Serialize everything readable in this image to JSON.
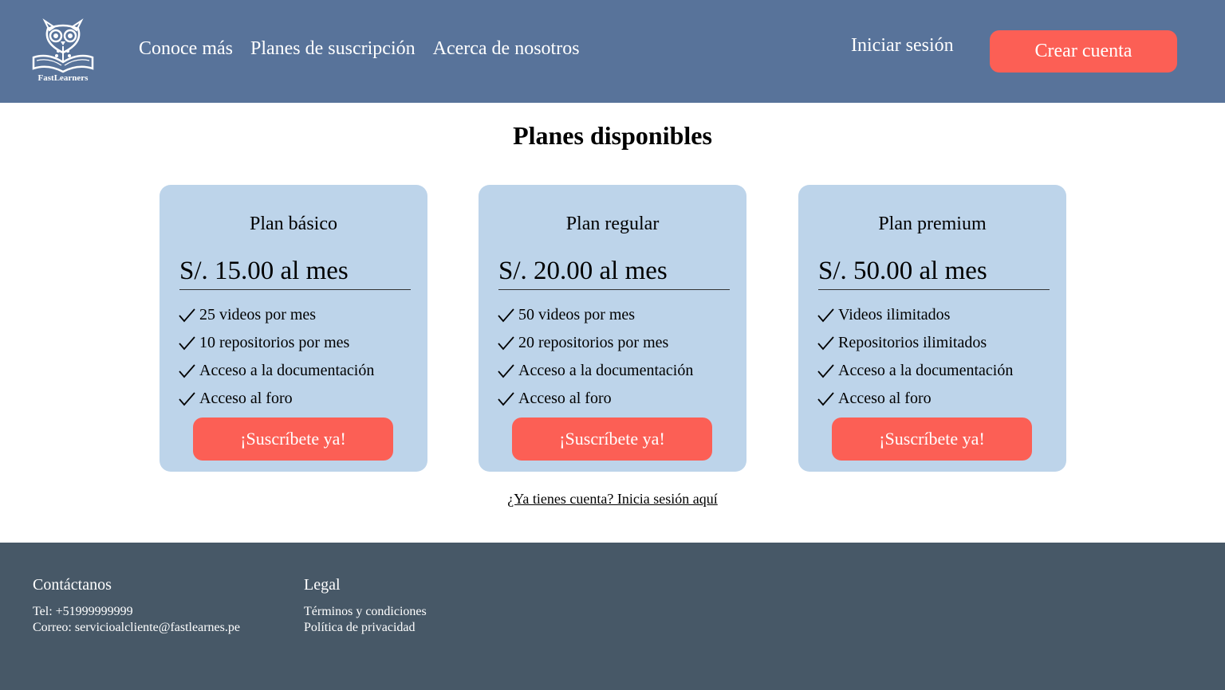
{
  "header": {
    "logo_text": "FastLearners",
    "nav": [
      "Conoce más",
      "Planes de suscripción",
      "Acerca de nosotros"
    ],
    "login": "Iniciar sesión",
    "signup": "Crear cuenta"
  },
  "main": {
    "title": "Planes disponibles",
    "plans": [
      {
        "name": "Plan básico",
        "price": "S/. 15.00 al mes",
        "features": [
          "25 videos por mes",
          "10 repositorios por mes",
          "Acceso a la documentación",
          "Acceso al foro"
        ],
        "cta": "¡Suscríbete ya!"
      },
      {
        "name": "Plan regular",
        "price": "S/. 20.00 al mes",
        "features": [
          "50 videos por mes",
          "20 repositorios por mes",
          "Acceso a la documentación",
          "Acceso al foro"
        ],
        "cta": "¡Suscríbete ya!"
      },
      {
        "name": "Plan premium",
        "price": "S/. 50.00 al mes",
        "features": [
          "Videos ilimitados",
          "Repositorios ilimitados",
          "Acceso a la documentación",
          "Acceso al foro"
        ],
        "cta": "¡Suscríbete ya!"
      }
    ],
    "login_prompt": "¿Ya tienes cuenta? Inicia sesión aquí"
  },
  "footer": {
    "contact": {
      "title": "Contáctanos",
      "tel": "Tel: +51999999999",
      "email": "Correo: servicioalcliente@fastlearnes.pe"
    },
    "legal": {
      "title": "Legal",
      "links": [
        "Términos y condiciones",
        "Política de privacidad"
      ]
    }
  },
  "colors": {
    "header_bg": "#58739a",
    "accent": "#fc5f55",
    "card_bg": "#bdd4ea",
    "footer_bg": "#475867"
  }
}
